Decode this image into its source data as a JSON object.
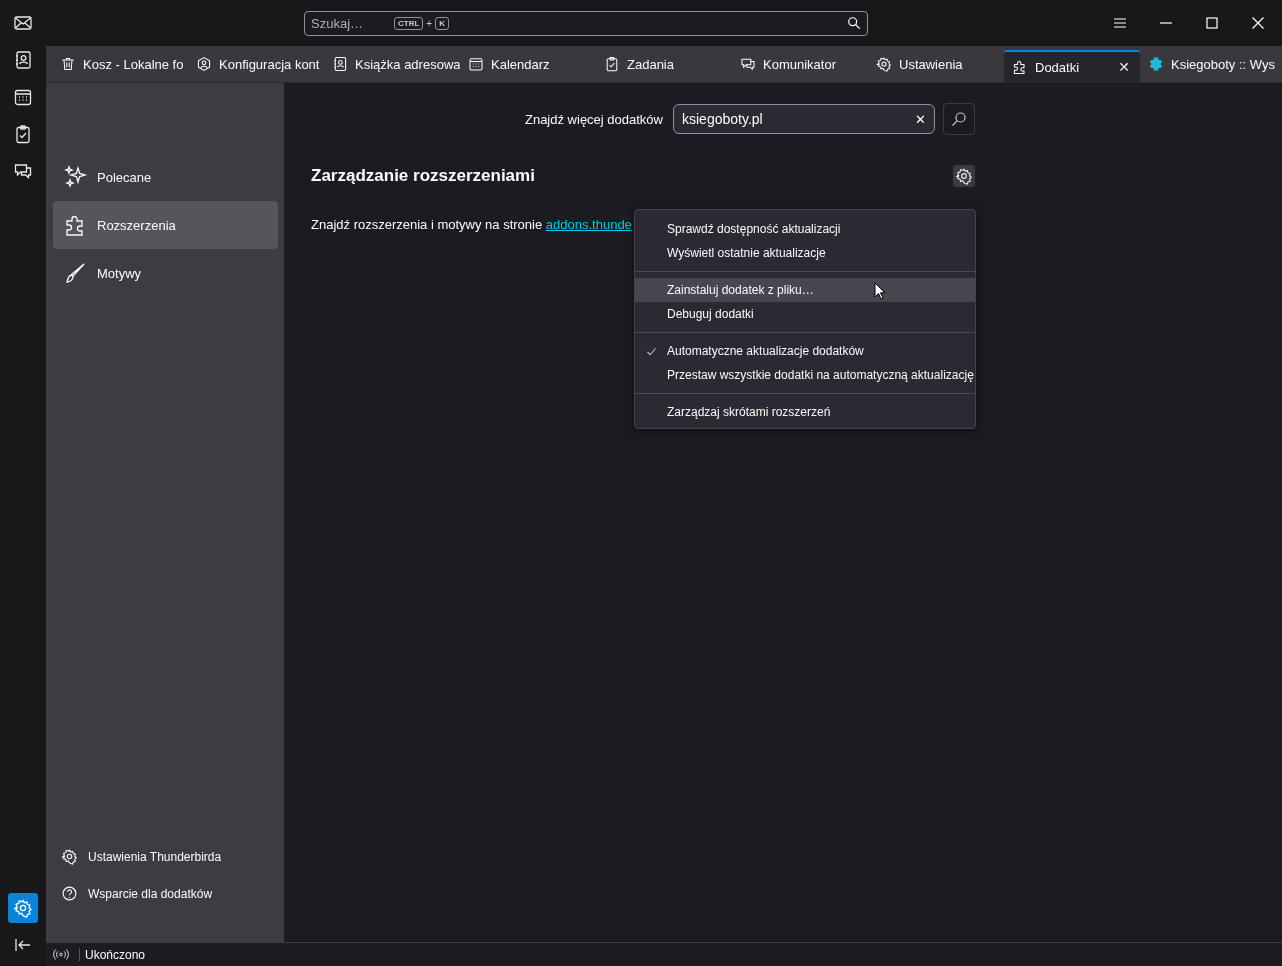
{
  "search": {
    "placeholder": "Szukaj…",
    "keys": [
      "CTRL",
      "+",
      "K"
    ]
  },
  "spaces": [
    {
      "kind": "mail",
      "selected": false
    },
    {
      "kind": "addressbook",
      "selected": false
    },
    {
      "kind": "calendar",
      "selected": false
    },
    {
      "kind": "tasks",
      "selected": false
    },
    {
      "kind": "chat",
      "selected": false
    }
  ],
  "spaces_bottom": [
    {
      "kind": "settings",
      "selected": true
    },
    {
      "kind": "collapse",
      "selected": false
    }
  ],
  "tabs": [
    {
      "kind": "trash",
      "label": "Kosz - Lokalne fo",
      "selected": false
    },
    {
      "kind": "account",
      "label": "Konfiguracja kont",
      "selected": false
    },
    {
      "kind": "addressbook",
      "label": "Książka adresowa",
      "selected": false
    },
    {
      "kind": "calendar",
      "label": "Kalendarz",
      "selected": false
    },
    {
      "kind": "tasks",
      "label": "Zadania",
      "selected": false
    },
    {
      "kind": "chat",
      "label": "Komunikator",
      "selected": false
    },
    {
      "kind": "settings",
      "label": "Ustawienia",
      "selected": false
    },
    {
      "kind": "addons",
      "label": "Dodatki",
      "selected": true,
      "close_glyph": "✕"
    },
    {
      "kind": "web",
      "label": "Ksiegoboty :: Wys",
      "selected": false
    }
  ],
  "sidebar": {
    "items": [
      {
        "kind": "sparkle",
        "label": "Polecane",
        "selected": false
      },
      {
        "kind": "addons",
        "label": "Rozszerzenia",
        "selected": true
      },
      {
        "kind": "brush",
        "label": "Motywy",
        "selected": false
      }
    ],
    "footer": [
      {
        "kind": "settings",
        "label": "Ustawienia Thunderbirda"
      },
      {
        "kind": "help",
        "label": "Wsparcie dla dodatków"
      }
    ]
  },
  "find_more": {
    "label": "Znajdź więcej dodatków",
    "value": "ksiegoboty.pl",
    "clear_glyph": "✕"
  },
  "heading": "Zarządzanie rozszerzeniami",
  "intro": {
    "text": "Znajdź rozszerzenia i motywy na stronie ",
    "link": "addons.thunde"
  },
  "menu": [
    {
      "kind": "item",
      "label": "Sprawdź dostępność aktualizacji",
      "checked": false,
      "hovered": false
    },
    {
      "kind": "item",
      "label": "Wyświetl ostatnie aktualizacje",
      "checked": false,
      "hovered": false
    },
    {
      "kind": "separator"
    },
    {
      "kind": "item",
      "label": "Zainstaluj dodatek z pliku…",
      "checked": false,
      "hovered": true
    },
    {
      "kind": "item",
      "label": "Debuguj dodatki",
      "checked": false,
      "hovered": false
    },
    {
      "kind": "separator"
    },
    {
      "kind": "item",
      "label": "Automatyczne aktualizacje dodatków",
      "checked": true,
      "hovered": false
    },
    {
      "kind": "item",
      "label": "Przestaw wszystkie dodatki na automatyczną aktualizację",
      "checked": false,
      "hovered": false
    },
    {
      "kind": "separator"
    },
    {
      "kind": "item",
      "label": "Zarządzaj skrótami rozszerzeń",
      "checked": false,
      "hovered": false
    }
  ],
  "status_bar": {
    "text": "Ukończono"
  }
}
